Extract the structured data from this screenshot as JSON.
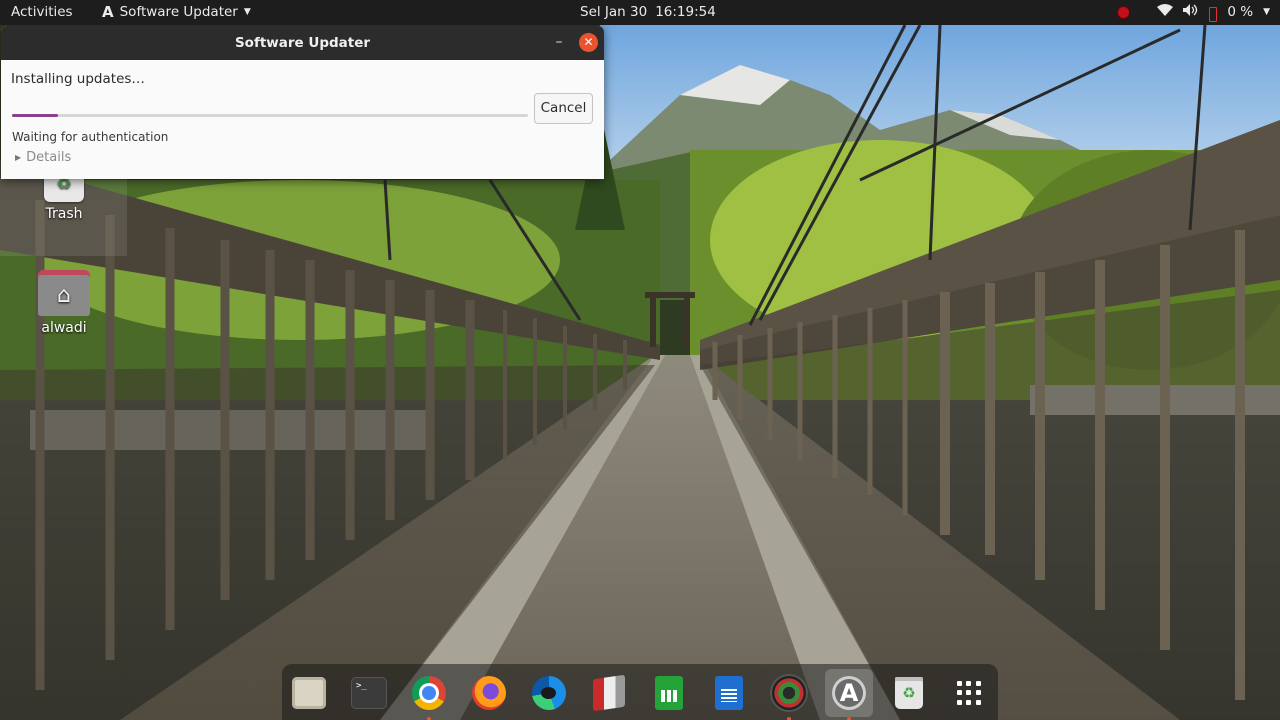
{
  "topbar": {
    "activities": "Activities",
    "app_name": "Software Updater",
    "clock_day": "Sel Jan 30",
    "clock_time": "16:19:54",
    "battery_text": "0 %"
  },
  "window": {
    "title": "Software Updater",
    "status": "Installing updates…",
    "progress_fraction": 0.09,
    "cancel_label": "Cancel",
    "substatus": "Waiting for authentication",
    "details_label": "Details"
  },
  "desktop": {
    "icons": [
      {
        "label": "Trash",
        "icon": "trash-icon"
      },
      {
        "label": "alwadi",
        "icon": "home-folder-icon"
      }
    ]
  },
  "dock": {
    "items": [
      {
        "name": "files",
        "icon": "files-icon",
        "running": false
      },
      {
        "name": "terminal",
        "icon": "terminal-icon",
        "running": false
      },
      {
        "name": "chrome",
        "icon": "chrome-icon",
        "running": true
      },
      {
        "name": "firefox",
        "icon": "firefox-icon",
        "running": false
      },
      {
        "name": "edge",
        "icon": "edge-icon",
        "running": false
      },
      {
        "name": "libreoffice-impress",
        "icon": "presentation-icon",
        "running": false
      },
      {
        "name": "libreoffice-calc",
        "icon": "spreadsheet-icon",
        "running": false
      },
      {
        "name": "libreoffice-writer",
        "icon": "document-icon",
        "running": false
      },
      {
        "name": "camera-app",
        "icon": "camera-icon",
        "running": true
      },
      {
        "name": "software-updater",
        "icon": "software-updater-icon",
        "running": true
      },
      {
        "name": "trash",
        "icon": "trash-icon",
        "running": false
      },
      {
        "name": "show-applications",
        "icon": "app-grid-icon",
        "running": false
      }
    ]
  },
  "colors": {
    "accent": "#8b3f8e",
    "close_button": "#e9542f",
    "topbar": "#1d1d1d"
  }
}
